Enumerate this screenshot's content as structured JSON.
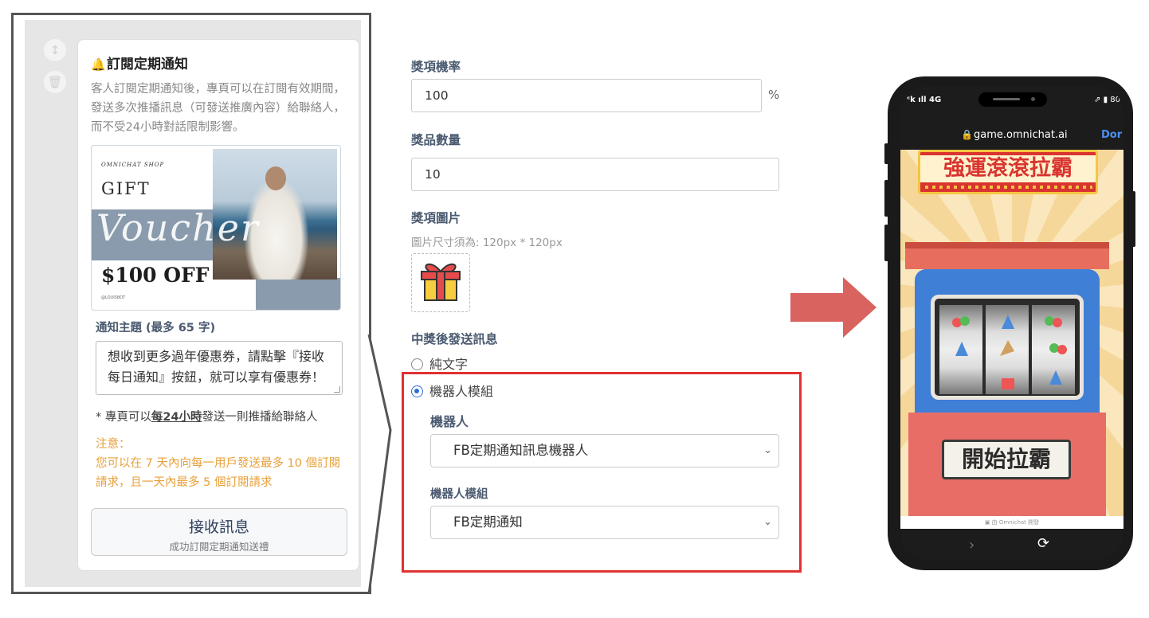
{
  "left": {
    "card_title": "訂閱定期通知",
    "card_desc": "客人訂閱定期通知後，專頁可以在訂閱有效期間，發送多次推播訊息（可發送推廣內容）給聯絡人，而不受24小時對話限制影響。",
    "voucher": {
      "shop": "OMNICHAT SHOP",
      "gift": "GIFT",
      "script": "Voucher",
      "amount": "$100 OFF",
      "small": "@LOUISBOT"
    },
    "topic_label": "通知主題 (最多 65 字)",
    "topic_value": "想收到更多過年優惠券，請點擊『接收每日通知』按鈕，就可以享有優惠券！",
    "note_prefix": "* 專頁可以",
    "note_emph": "每24小時",
    "note_suffix": "發送一則推播給聯絡人",
    "warn_title": "注意：",
    "warn_text": "您可以在 7 天內向每一用戶發送最多 10 個訂閱請求，且一天內最多 5 個訂閱請求",
    "button_main": "接收訊息",
    "button_sub": "成功訂閱定期通知送禮"
  },
  "form": {
    "prob_label": "獎項機率",
    "prob_value": "100",
    "prob_unit": "%",
    "qty_label": "獎品數量",
    "qty_value": "10",
    "img_label": "獎項圖片",
    "img_hint": "圖片尺寸須為: 120px * 120px",
    "msg_label": "中獎後發送訊息",
    "radio_text": "純文字",
    "radio_bot": "機器人模組",
    "bot_label": "機器人",
    "bot_value": "FB定期通知訊息機器人",
    "module_label": "機器人模組",
    "module_value": "FB定期通知"
  },
  "phone": {
    "status_left": "ᶜk ıll 4G",
    "status_right": "⇗ ▮ 80",
    "url": "game.omnichat.ai",
    "url_done": "Dor",
    "marquee": "強運滾滾拉霸",
    "start": "開始拉霸",
    "footer": "▣ 由 Omnichat 開發"
  },
  "colors": {
    "accent_red": "#e03232",
    "warn_orange": "#e8a03a",
    "arrow": "#d9635f",
    "radio_blue": "#2c6ed5"
  }
}
